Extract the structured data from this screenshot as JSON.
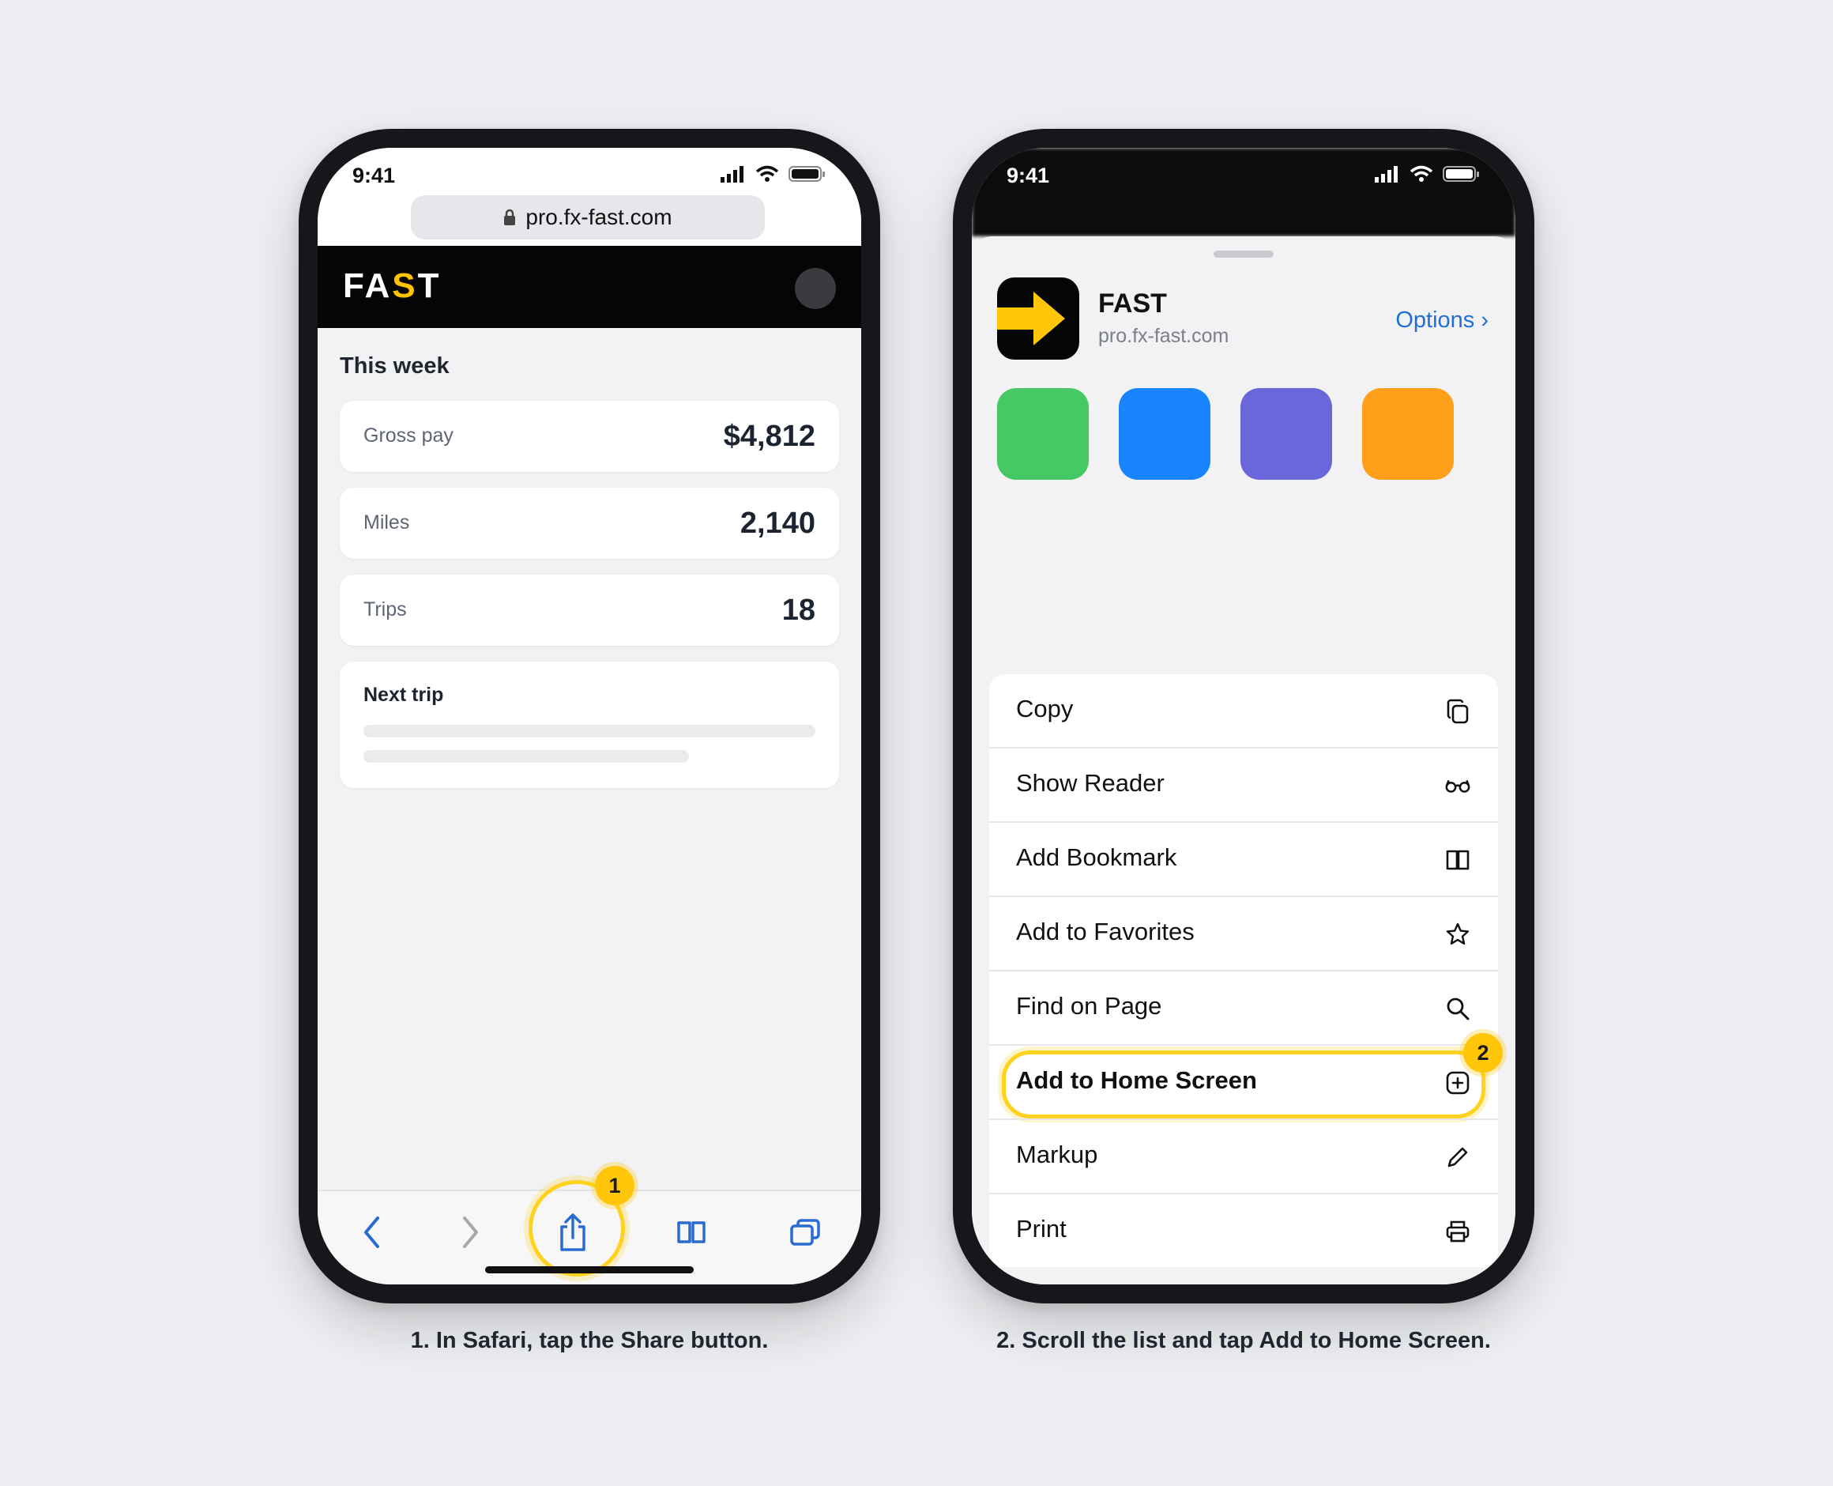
{
  "left_phone": {
    "status": {
      "time": "9:41"
    },
    "url": "pro.fx-fast.com",
    "logo": {
      "prefix": "FA",
      "highlight": "S",
      "suffix": "T"
    },
    "section_title": "This week",
    "stats": [
      {
        "label": "Gross pay",
        "value": "$4,812"
      },
      {
        "label": "Miles",
        "value": "2,140"
      },
      {
        "label": "Trips",
        "value": "18"
      }
    ],
    "next_trip_label": "Next trip",
    "step_badge": "1",
    "caption": "1. In Safari, tap the Share button."
  },
  "right_phone": {
    "status": {
      "time": "9:41"
    },
    "app": {
      "name": "FAST",
      "url": "pro.fx-fast.com",
      "options_label": "Options ›"
    },
    "swatch_colors": [
      "#46c864",
      "#1a84ff",
      "#6a67da",
      "#ff9f1a"
    ],
    "actions": [
      {
        "label": "Copy",
        "icon": "copy-icon"
      },
      {
        "label": "Show Reader",
        "icon": "reader-glasses-icon"
      },
      {
        "label": "Add Bookmark",
        "icon": "book-icon"
      },
      {
        "label": "Add to Favorites",
        "icon": "star-icon"
      },
      {
        "label": "Find on Page",
        "icon": "search-icon"
      },
      {
        "label": "Add to Home Screen",
        "icon": "plus-square-icon"
      },
      {
        "label": "Markup",
        "icon": "pencil-icon"
      },
      {
        "label": "Print",
        "icon": "printer-icon"
      }
    ],
    "step_badge": "2",
    "caption": "2. Scroll the list and tap Add to Home Screen."
  },
  "colors": {
    "accent_yellow": "#ffc60a",
    "link_blue": "#1f6fd6",
    "toolbar_blue": "#2a6bd1"
  }
}
